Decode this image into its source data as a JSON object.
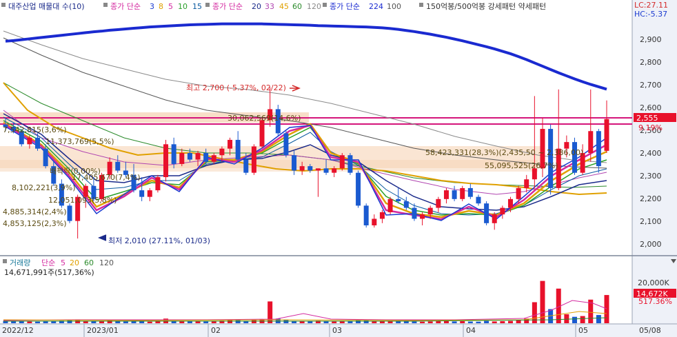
{
  "legend": {
    "title": "대주산업 매물대 수(10)",
    "ma_short_label": "종가 단순",
    "ma_short": [
      "3",
      "8",
      "5",
      "10",
      "15"
    ],
    "ma_mid_label": "종가 단순",
    "ma_mid": [
      "20",
      "33",
      "45",
      "60",
      "120"
    ],
    "ma_long_label": "종가 단순",
    "ma_long": [
      "224",
      "100"
    ],
    "pattern_label": "150억봉/500억봉 강세패턴  약세패턴",
    "lc": "LC:27.11",
    "hc": "HC:-5.37"
  },
  "annotations": {
    "high": "최고 2,700 (-5.37%, 02/22)",
    "low": "최저 2,010 (27.11%, 01/03)"
  },
  "volume_profile_labels": [
    "30,062,569(14,6%)",
    "58,423,331(28,3%)(2,435,50 ~ 2,386,00)",
    "55,095,525(26,7%)",
    "7,542,815(3,6%)",
    "11,373,769(5,5%)",
    "배팍락(0,00%)",
    "17,405,670(7,4%)",
    "8,102,221(3,9%)",
    "12,051,093(5,8%)",
    "4,885,314(2,4%)",
    "4,853,125(2,3%)"
  ],
  "price_badge": "2,555",
  "price_pct": "9.19%",
  "volume_legend": {
    "label": "거래량",
    "ma_label": "단순",
    "ma": [
      "5",
      "20",
      "60",
      "120"
    ],
    "current": "14,671,991주(517,36%)"
  },
  "volume_badge": "14,672K",
  "volume_pct": "517.36%",
  "x_ticks": [
    "2022/12",
    "2023/01",
    "02",
    "03",
    "04",
    "05",
    "05/08"
  ],
  "y_ticks_price": [
    "2,900",
    "2,800",
    "2,700",
    "2,600",
    "2,500",
    "2,400",
    "2,300",
    "2,200",
    "2,100",
    "2,000"
  ],
  "y_tick_volume": "20,000K",
  "chart_data": {
    "type": "candlestick",
    "ylim": [
      1960,
      3010
    ],
    "volume_ylim": [
      0,
      25000
    ],
    "candles": [
      {
        "o": 2530,
        "h": 2560,
        "l": 2500,
        "c": 2520
      },
      {
        "o": 2520,
        "h": 2540,
        "l": 2490,
        "c": 2500
      },
      {
        "o": 2500,
        "h": 2510,
        "l": 2430,
        "c": 2440
      },
      {
        "o": 2440,
        "h": 2480,
        "l": 2420,
        "c": 2470
      },
      {
        "o": 2470,
        "h": 2490,
        "l": 2410,
        "c": 2420
      },
      {
        "o": 2420,
        "h": 2440,
        "l": 2330,
        "c": 2340
      },
      {
        "o": 2340,
        "h": 2360,
        "l": 2250,
        "c": 2260
      },
      {
        "o": 2260,
        "h": 2280,
        "l": 2150,
        "c": 2160
      },
      {
        "o": 2160,
        "h": 2170,
        "l": 2080,
        "c": 2090
      },
      {
        "o": 2090,
        "h": 2210,
        "l": 2010,
        "c": 2200
      },
      {
        "o": 2200,
        "h": 2260,
        "l": 2150,
        "c": 2250
      },
      {
        "o": 2250,
        "h": 2290,
        "l": 2180,
        "c": 2190
      },
      {
        "o": 2190,
        "h": 2310,
        "l": 2180,
        "c": 2300
      },
      {
        "o": 2300,
        "h": 2380,
        "l": 2280,
        "c": 2360
      },
      {
        "o": 2360,
        "h": 2390,
        "l": 2310,
        "c": 2320
      },
      {
        "o": 2320,
        "h": 2360,
        "l": 2290,
        "c": 2300
      },
      {
        "o": 2300,
        "h": 2350,
        "l": 2220,
        "c": 2230
      },
      {
        "o": 2230,
        "h": 2290,
        "l": 2180,
        "c": 2200
      },
      {
        "o": 2200,
        "h": 2240,
        "l": 2180,
        "c": 2230
      },
      {
        "o": 2230,
        "h": 2300,
        "l": 2220,
        "c": 2290
      },
      {
        "o": 2290,
        "h": 2460,
        "l": 2270,
        "c": 2440
      },
      {
        "o": 2440,
        "h": 2470,
        "l": 2330,
        "c": 2350
      },
      {
        "o": 2350,
        "h": 2420,
        "l": 2340,
        "c": 2400
      },
      {
        "o": 2400,
        "h": 2420,
        "l": 2360,
        "c": 2370
      },
      {
        "o": 2370,
        "h": 2410,
        "l": 2340,
        "c": 2400
      },
      {
        "o": 2400,
        "h": 2420,
        "l": 2350,
        "c": 2360
      },
      {
        "o": 2360,
        "h": 2400,
        "l": 2350,
        "c": 2390
      },
      {
        "o": 2390,
        "h": 2430,
        "l": 2360,
        "c": 2420
      },
      {
        "o": 2420,
        "h": 2470,
        "l": 2390,
        "c": 2460
      },
      {
        "o": 2460,
        "h": 2500,
        "l": 2360,
        "c": 2370
      },
      {
        "o": 2370,
        "h": 2400,
        "l": 2300,
        "c": 2310
      },
      {
        "o": 2310,
        "h": 2440,
        "l": 2300,
        "c": 2430
      },
      {
        "o": 2430,
        "h": 2560,
        "l": 2420,
        "c": 2550
      },
      {
        "o": 2550,
        "h": 2700,
        "l": 2520,
        "c": 2600
      },
      {
        "o": 2600,
        "h": 2620,
        "l": 2480,
        "c": 2490
      },
      {
        "o": 2490,
        "h": 2500,
        "l": 2380,
        "c": 2390
      },
      {
        "o": 2390,
        "h": 2410,
        "l": 2300,
        "c": 2320
      },
      {
        "o": 2320,
        "h": 2360,
        "l": 2300,
        "c": 2340
      },
      {
        "o": 2340,
        "h": 2350,
        "l": 2310,
        "c": 2320
      },
      {
        "o": 2320,
        "h": 2330,
        "l": 2200,
        "c": 2330
      },
      {
        "o": 2330,
        "h": 2370,
        "l": 2300,
        "c": 2310
      },
      {
        "o": 2310,
        "h": 2340,
        "l": 2290,
        "c": 2330
      },
      {
        "o": 2330,
        "h": 2400,
        "l": 2320,
        "c": 2390
      },
      {
        "o": 2390,
        "h": 2400,
        "l": 2300,
        "c": 2310
      },
      {
        "o": 2310,
        "h": 2320,
        "l": 2150,
        "c": 2160
      },
      {
        "o": 2160,
        "h": 2170,
        "l": 2060,
        "c": 2070
      },
      {
        "o": 2070,
        "h": 2120,
        "l": 2060,
        "c": 2100
      },
      {
        "o": 2100,
        "h": 2140,
        "l": 2080,
        "c": 2130
      },
      {
        "o": 2130,
        "h": 2200,
        "l": 2120,
        "c": 2190
      },
      {
        "o": 2190,
        "h": 2240,
        "l": 2170,
        "c": 2180
      },
      {
        "o": 2180,
        "h": 2200,
        "l": 2140,
        "c": 2150
      },
      {
        "o": 2150,
        "h": 2170,
        "l": 2090,
        "c": 2100
      },
      {
        "o": 2100,
        "h": 2130,
        "l": 2070,
        "c": 2120
      },
      {
        "o": 2120,
        "h": 2160,
        "l": 2100,
        "c": 2150
      },
      {
        "o": 2150,
        "h": 2200,
        "l": 2130,
        "c": 2190
      },
      {
        "o": 2190,
        "h": 2240,
        "l": 2170,
        "c": 2230
      },
      {
        "o": 2230,
        "h": 2250,
        "l": 2180,
        "c": 2190
      },
      {
        "o": 2190,
        "h": 2250,
        "l": 2180,
        "c": 2240
      },
      {
        "o": 2240,
        "h": 2260,
        "l": 2190,
        "c": 2200
      },
      {
        "o": 2200,
        "h": 2210,
        "l": 2160,
        "c": 2170
      },
      {
        "o": 2170,
        "h": 2180,
        "l": 2070,
        "c": 2080
      },
      {
        "o": 2080,
        "h": 2130,
        "l": 2050,
        "c": 2120
      },
      {
        "o": 2120,
        "h": 2160,
        "l": 2100,
        "c": 2150
      },
      {
        "o": 2150,
        "h": 2200,
        "l": 2130,
        "c": 2190
      },
      {
        "o": 2190,
        "h": 2250,
        "l": 2170,
        "c": 2240
      },
      {
        "o": 2240,
        "h": 2300,
        "l": 2220,
        "c": 2280
      },
      {
        "o": 2280,
        "h": 2660,
        "l": 2240,
        "c": 2330
      },
      {
        "o": 2330,
        "h": 2560,
        "l": 2290,
        "c": 2510
      },
      {
        "o": 2510,
        "h": 2530,
        "l": 2210,
        "c": 2240
      },
      {
        "o": 2240,
        "h": 2690,
        "l": 2230,
        "c": 2420
      },
      {
        "o": 2420,
        "h": 2480,
        "l": 2380,
        "c": 2450
      },
      {
        "o": 2450,
        "h": 2470,
        "l": 2300,
        "c": 2310
      },
      {
        "o": 2310,
        "h": 2440,
        "l": 2300,
        "c": 2400
      },
      {
        "o": 2400,
        "h": 2690,
        "l": 2360,
        "c": 2500
      },
      {
        "o": 2500,
        "h": 2510,
        "l": 2310,
        "c": 2340
      },
      {
        "o": 2410,
        "h": 2640,
        "l": 2400,
        "c": 2555
      }
    ],
    "volumes": [
      900,
      700,
      800,
      650,
      600,
      900,
      800,
      1000,
      1200,
      1500,
      900,
      800,
      850,
      1100,
      700,
      650,
      750,
      700,
      600,
      800,
      1800,
      900,
      750,
      700,
      800,
      650,
      900,
      1000,
      1200,
      1400,
      900,
      1200,
      1600,
      8500,
      1800,
      1200,
      900,
      800,
      700,
      1000,
      700,
      650,
      900,
      800,
      1100,
      1200,
      800,
      700,
      900,
      800,
      700,
      650,
      600,
      700,
      800,
      900,
      700,
      800,
      650,
      600,
      900,
      700,
      800,
      900,
      1200,
      1800,
      8200,
      16500,
      5500,
      13500,
      3500,
      2500,
      2800,
      9200,
      3200,
      11000
    ],
    "ma224": [
      2910,
      2913,
      2917,
      2921,
      2925,
      2929,
      2933,
      2937,
      2941,
      2945,
      2949,
      2953,
      2956,
      2960,
      2963,
      2966,
      2969,
      2972,
      2975,
      2977,
      2979,
      2981,
      2983,
      2985,
      2986,
      2987,
      2988,
      2989,
      2989,
      2989,
      2989,
      2989,
      2989,
      2988,
      2987,
      2986,
      2985,
      2984,
      2983,
      2981,
      2980,
      2979,
      2978,
      2977,
      2976,
      2975,
      2973,
      2971,
      2968,
      2964,
      2959,
      2954,
      2948,
      2942,
      2935,
      2928,
      2920,
      2912,
      2903,
      2894,
      2885,
      2875,
      2864,
      2853,
      2840,
      2826,
      2811,
      2796,
      2781,
      2766,
      2752,
      2738,
      2725,
      2713,
      2702,
      2691
    ]
  }
}
